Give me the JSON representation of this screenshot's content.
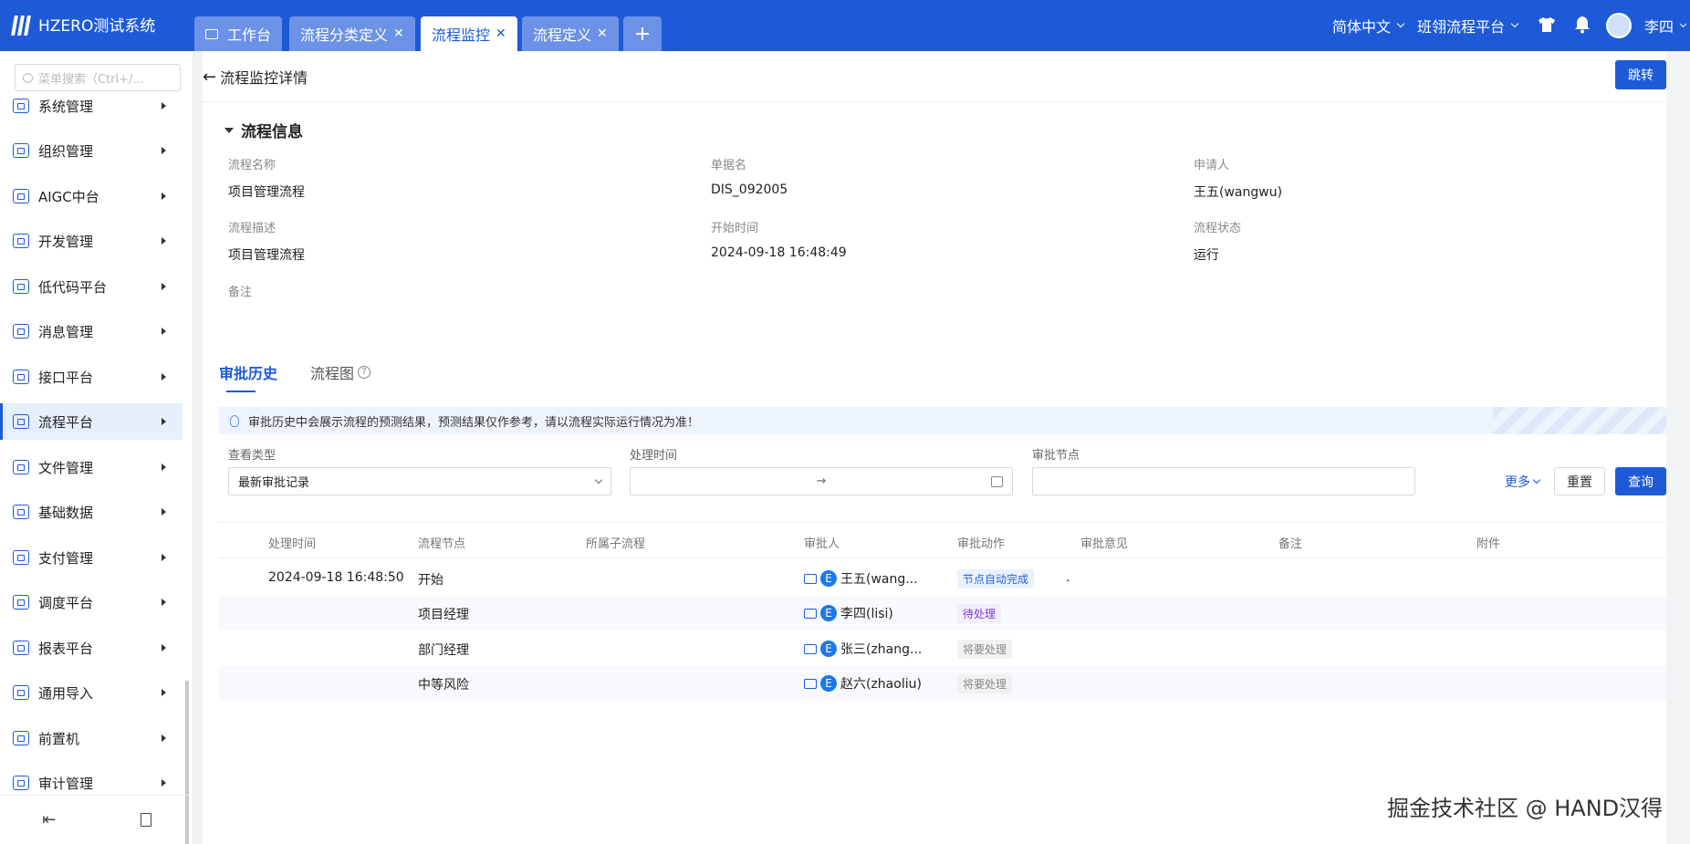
{
  "app": {
    "title": "HZERO测试系统"
  },
  "tabs": [
    {
      "label": "工作台",
      "active": false,
      "closable": false
    },
    {
      "label": "流程分类定义",
      "active": false,
      "closable": true
    },
    {
      "label": "流程监控",
      "active": true,
      "closable": true
    },
    {
      "label": "流程定义",
      "active": false,
      "closable": true
    }
  ],
  "topbar": {
    "language": "简体中文",
    "platform": "班翎流程平台",
    "user": "李四"
  },
  "sidebar": {
    "search_placeholder": "菜单搜索（Ctrl+/...",
    "items": [
      {
        "label": "系统管理",
        "icon": "settings-icon",
        "active": false
      },
      {
        "label": "组织管理",
        "icon": "org-icon",
        "active": false
      },
      {
        "label": "AIGC中台",
        "icon": "ai-icon",
        "active": false
      },
      {
        "label": "开发管理",
        "icon": "code-icon",
        "active": false
      },
      {
        "label": "低代码平台",
        "icon": "lowcode-icon",
        "active": false
      },
      {
        "label": "消息管理",
        "icon": "message-icon",
        "active": false
      },
      {
        "label": "接口平台",
        "icon": "interface-icon",
        "active": false
      },
      {
        "label": "流程平台",
        "icon": "workflow-icon",
        "active": true
      },
      {
        "label": "文件管理",
        "icon": "file-icon",
        "active": false
      },
      {
        "label": "基础数据",
        "icon": "data-icon",
        "active": false
      },
      {
        "label": "支付管理",
        "icon": "payment-icon",
        "active": false
      },
      {
        "label": "调度平台",
        "icon": "schedule-icon",
        "active": false
      },
      {
        "label": "报表平台",
        "icon": "report-icon",
        "active": false
      },
      {
        "label": "通用导入",
        "icon": "import-icon",
        "active": false
      },
      {
        "label": "前置机",
        "icon": "frontend-icon",
        "active": false
      },
      {
        "label": "审计管理",
        "icon": "audit-icon",
        "active": false
      }
    ]
  },
  "page": {
    "back_title": "流程监控详情",
    "jump_button": "跳转"
  },
  "info": {
    "section_title": "流程信息",
    "fields": {
      "flow_name": {
        "label": "流程名称",
        "value": "项目管理流程"
      },
      "doc_name": {
        "label": "单据名",
        "value": "DIS_092005"
      },
      "applicant": {
        "label": "申请人",
        "value": "王五(wangwu)"
      },
      "flow_desc": {
        "label": "流程描述",
        "value": "项目管理流程"
      },
      "start_time": {
        "label": "开始时间",
        "value": "2024-09-18 16:48:49"
      },
      "flow_status": {
        "label": "流程状态",
        "value": "运行"
      },
      "remark": {
        "label": "备注",
        "value": ""
      }
    }
  },
  "history_tabs": {
    "history": "审批历史",
    "diagram": "流程图"
  },
  "notice": "审批历史中会展示流程的预测结果，预测结果仅作参考，请以流程实际运行情况为准！",
  "filters": {
    "view_type": {
      "label": "查看类型",
      "value": "最新审批记录"
    },
    "process_time": {
      "label": "处理时间",
      "separator": "→"
    },
    "approval_node": {
      "label": "审批节点",
      "value": ""
    },
    "more": "更多",
    "reset": "重置",
    "query": "查询"
  },
  "table": {
    "headers": [
      "处理时间",
      "流程节点",
      "所属子流程",
      "审批人",
      "审批动作",
      "审批意见",
      "备注",
      "附件"
    ],
    "rows": [
      {
        "time": "2024-09-18 16:48:50",
        "node": "开始",
        "approver": "王五(wang...",
        "action": "节点自动完成",
        "action_style": "blue",
        "opinion": "."
      },
      {
        "time": "",
        "node": "项目经理",
        "approver": "李四(lisi)",
        "action": "待处理",
        "action_style": "purple",
        "opinion": ""
      },
      {
        "time": "",
        "node": "部门经理",
        "approver": "张三(zhang...",
        "action": "将要处理",
        "action_style": "gray",
        "opinion": ""
      },
      {
        "time": "",
        "node": "中等风险",
        "approver": "赵六(zhaoliu)",
        "action": "将要处理",
        "action_style": "gray",
        "opinion": ""
      }
    ]
  },
  "watermark": "掘金技术社区 @ HAND汉得",
  "colors": {
    "primary": "#1e5ad8",
    "sidebar_active": "#e6effc"
  }
}
